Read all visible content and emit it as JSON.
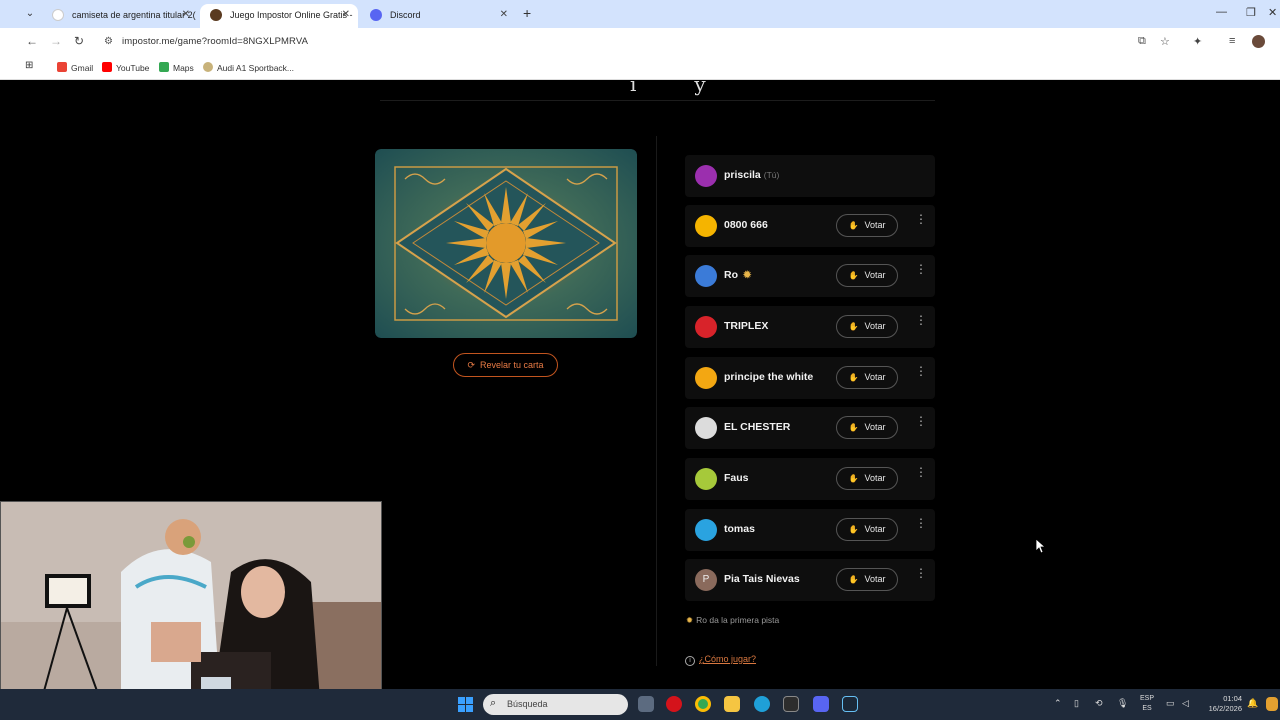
{
  "browser": {
    "tabs": [
      {
        "title": "camiseta de argentina titular 2(",
        "active": false
      },
      {
        "title": "Juego Impostor Online Gratis -",
        "active": true
      },
      {
        "title": "Discord",
        "active": false
      }
    ],
    "url": "impostor.me/game?roomId=8NGXLPMRVA",
    "bookmarks": [
      "Gmail",
      "YouTube",
      "Maps",
      "Audi A1 Sportback..."
    ]
  },
  "game": {
    "reveal_label": "Revelar tu carta",
    "vote_label": "Votar",
    "players": [
      {
        "name": "priscila",
        "you": "(Tú)",
        "color": "#9b2fae"
      },
      {
        "name": "0800 666",
        "color": "#f5b400"
      },
      {
        "name": "Ro",
        "color": "#3b7bd8",
        "first": true
      },
      {
        "name": "TRIPLEX",
        "color": "#d8232a"
      },
      {
        "name": "principe the white",
        "color": "#f3a712"
      },
      {
        "name": "EL CHESTER",
        "color": "#dcdcdc"
      },
      {
        "name": "Faus",
        "color": "#a6c93a"
      },
      {
        "name": "tomas",
        "color": "#2aa3e0"
      },
      {
        "name": "Pia Tais Nievas",
        "initial": "P",
        "color": "#8a6a5c"
      }
    ],
    "first_clue": "Ro da la primera pista",
    "howto": "¿Cómo jugar?"
  },
  "taskbar": {
    "search_placeholder": "Búsqueda",
    "lang_top": "ESP",
    "lang_bottom": "ES",
    "time": "01:04",
    "date": "16/2/2026"
  }
}
